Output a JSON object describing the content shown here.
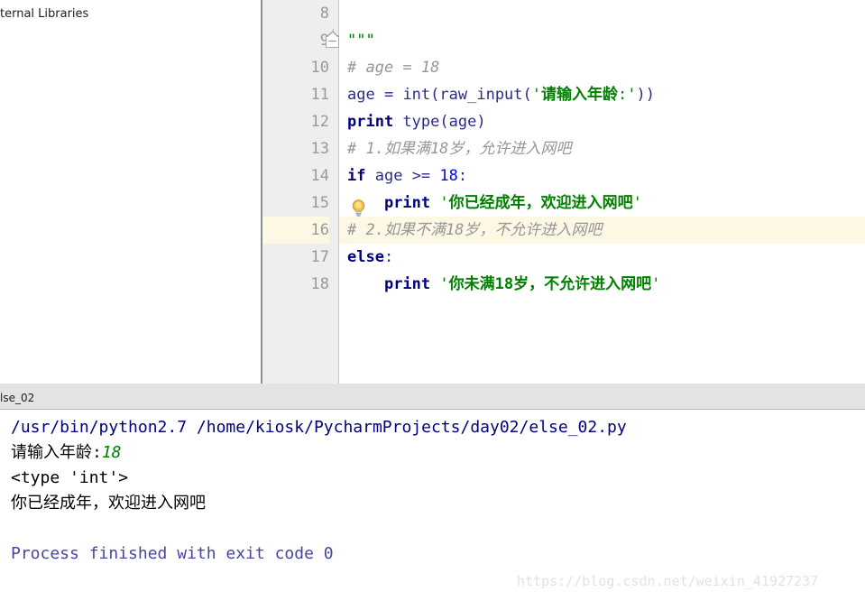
{
  "project_panel": {
    "clipped_tree_label": "ternal Libraries"
  },
  "editor": {
    "first_visible_line": 8,
    "highlighted_line": 16,
    "fold_marker_line": 9,
    "intention_bulb_icon": "lightbulb-icon",
    "lines": [
      {
        "num": "8",
        "tokens": []
      },
      {
        "num": "9",
        "tokens": [
          {
            "t": "\"\"\"",
            "c": "tok-strq"
          }
        ]
      },
      {
        "num": "10",
        "tokens": [
          {
            "t": "# age = 18",
            "c": "tok-comment"
          }
        ]
      },
      {
        "num": "11",
        "tokens": [
          {
            "t": "age",
            "c": "tok-ident"
          },
          {
            "t": " = ",
            "c": "tok-op"
          },
          {
            "t": "int",
            "c": "tok-ident"
          },
          {
            "t": "(",
            "c": "tok-op"
          },
          {
            "t": "raw_input",
            "c": "tok-ident"
          },
          {
            "t": "(",
            "c": "tok-op"
          },
          {
            "t": "'",
            "c": "tok-strq"
          },
          {
            "t": "请输入年龄",
            "c": "tok-str"
          },
          {
            "t": ":",
            "c": "tok-strq"
          },
          {
            "t": "'",
            "c": "tok-strq"
          },
          {
            "t": "))",
            "c": "tok-op"
          }
        ]
      },
      {
        "num": "12",
        "tokens": [
          {
            "t": "print",
            "c": "tok-kw"
          },
          {
            "t": " ",
            "c": "tok-op"
          },
          {
            "t": "type",
            "c": "tok-ident"
          },
          {
            "t": "(",
            "c": "tok-op"
          },
          {
            "t": "age",
            "c": "tok-ident"
          },
          {
            "t": ")",
            "c": "tok-op"
          }
        ]
      },
      {
        "num": "13",
        "tokens": [
          {
            "t": "# 1.如果满18岁，允许进入网吧",
            "c": "tok-comment"
          }
        ]
      },
      {
        "num": "14",
        "tokens": [
          {
            "t": "if",
            "c": "tok-kw"
          },
          {
            "t": " ",
            "c": "tok-op"
          },
          {
            "t": "age",
            "c": "tok-ident"
          },
          {
            "t": " >= ",
            "c": "tok-op"
          },
          {
            "t": "18",
            "c": "tok-num"
          },
          {
            "t": ":",
            "c": "tok-op"
          }
        ]
      },
      {
        "num": "15",
        "tokens": [
          {
            "t": "    ",
            "c": "tok-op"
          },
          {
            "t": "print",
            "c": "tok-kw"
          },
          {
            "t": " ",
            "c": "tok-op"
          },
          {
            "t": "'",
            "c": "tok-strq"
          },
          {
            "t": "你已经成年，欢迎进入网吧",
            "c": "tok-str"
          },
          {
            "t": "'",
            "c": "tok-strq"
          }
        ]
      },
      {
        "num": "16",
        "tokens": [
          {
            "t": "# 2.如果不满18岁，不允许进入网吧",
            "c": "tok-comment"
          }
        ]
      },
      {
        "num": "17",
        "tokens": [
          {
            "t": "else",
            "c": "tok-kw"
          },
          {
            "t": ":",
            "c": "tok-op"
          }
        ]
      },
      {
        "num": "18",
        "tokens": [
          {
            "t": "    ",
            "c": "tok-op"
          },
          {
            "t": "print",
            "c": "tok-kw"
          },
          {
            "t": " ",
            "c": "tok-op"
          },
          {
            "t": "'",
            "c": "tok-strq"
          },
          {
            "t": "你未满18岁，不允许进入网吧",
            "c": "tok-str"
          },
          {
            "t": "'",
            "c": "tok-strq"
          }
        ]
      }
    ]
  },
  "run_window": {
    "tab_label_clipped": "lse_02",
    "console_lines": [
      {
        "text": "/usr/bin/python2.7 /home/kiosk/PycharmProjects/day02/else_02.py",
        "c": "con-cmd"
      },
      {
        "prompt": "请输入年龄:",
        "input": "18",
        "c": "con-out",
        "input_c": "con-input"
      },
      {
        "text": "<type 'int'>",
        "c": "con-out"
      },
      {
        "text": "你已经成年，欢迎进入网吧",
        "c": "con-out"
      },
      {
        "text": " ",
        "c": "con-blank"
      },
      {
        "text": "Process finished with exit code 0",
        "c": "con-finish"
      }
    ]
  },
  "watermark": {
    "text": "https://blog.csdn.net/weixin_41927237"
  },
  "colors": {
    "keyword": "#000080",
    "string": "#008000",
    "comment": "#969696",
    "number": "#0000ff",
    "identifier": "#2b2b8f",
    "line_highlight": "#fcf8e4",
    "gutter_bg": "#eeeeee",
    "console_cmd": "#000080",
    "console_finish": "#4646a0"
  }
}
